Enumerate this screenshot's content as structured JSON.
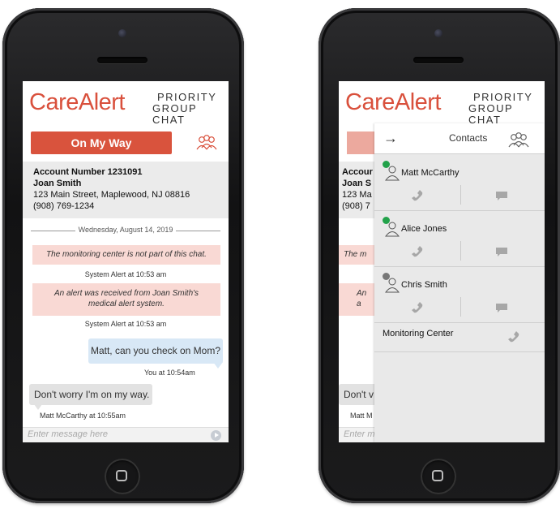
{
  "brand": {
    "name": "CareAlert",
    "sub_line1": "PRIORITY",
    "sub_line2": "GROUP CHAT",
    "color": "#d9503c"
  },
  "chat_screen": {
    "on_my_way_label": "On My Way",
    "group_icon": "group-people-icon",
    "account": {
      "number": "Account Number 1231091",
      "name": "Joan Smith",
      "address": "123 Main Street, Maplewood, NJ 08816",
      "phone": "(908) 769-1234"
    },
    "date_divider": "Wednesday, August 14, 2019",
    "messages": [
      {
        "type": "system",
        "text": "The monitoring center is not part of this chat.",
        "timestamp": "System Alert at 10:53 am"
      },
      {
        "type": "system",
        "text": "An alert was received from Joan Smith's medical alert system.",
        "timestamp": "System Alert at 10:53 am"
      },
      {
        "type": "outgoing",
        "text": "Matt, can you check on Mom?",
        "timestamp": "You at 10:54am"
      },
      {
        "type": "incoming",
        "text": "Don't worry I'm on my way.",
        "timestamp": "Matt McCarthy at 10:55am"
      }
    ],
    "input_placeholder": "Enter message here"
  },
  "contacts_screen": {
    "title": "Contacts",
    "back_icon": "arrow-right-icon",
    "contacts": [
      {
        "name": "Matt McCarthy",
        "status": "online",
        "status_color": "#22a24a"
      },
      {
        "name": "Alice Jones",
        "status": "online",
        "status_color": "#22a24a"
      },
      {
        "name": "Chris Smith",
        "status": "unavailable",
        "status_color": "#777777"
      }
    ],
    "monitoring_center": "Monitoring Center",
    "background_fragments": {
      "acct1": "Accour",
      "acct2": "Joan S",
      "acct3": "123 Ma",
      "acct4": "(908) 7",
      "msg1": "The m",
      "msg2": "An a",
      "msg3": "Don't v",
      "msg4": "Matt M",
      "input": "Enter m"
    }
  }
}
